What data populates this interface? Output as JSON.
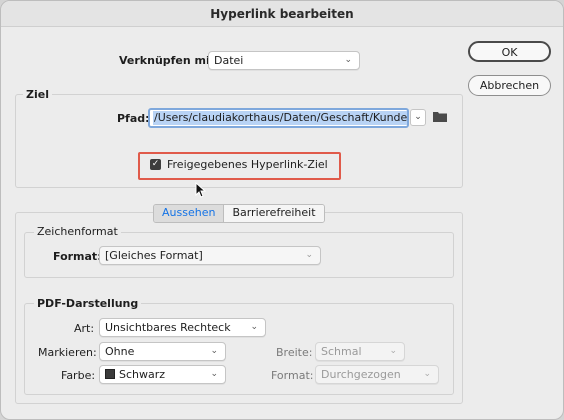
{
  "window": {
    "title": "Hyperlink bearbeiten"
  },
  "buttons": {
    "ok": "OK",
    "cancel": "Abbrechen"
  },
  "link": {
    "label": "Verknüpfen mit:",
    "value": "Datei"
  },
  "ziel": {
    "title": "Ziel",
    "path_label": "Pfad:",
    "path_value": "/Users/claudiakorthaus/Daten/Geschaft/Kunde",
    "checkbox_label": "Freigegebenes Hyperlink-Ziel",
    "checkbox_checked": true
  },
  "tabs": [
    {
      "label": "Aussehen",
      "active": true
    },
    {
      "label": "Barrierefreiheit",
      "active": false
    }
  ],
  "zeichenformat": {
    "title": "Zeichenformat",
    "format_label": "Format:",
    "format_value": "[Gleiches Format]"
  },
  "pdf": {
    "title": "PDF-Darstellung",
    "art_label": "Art:",
    "art_value": "Unsichtbares Rechteck",
    "markieren_label": "Markieren:",
    "markieren_value": "Ohne",
    "breite_label": "Breite:",
    "breite_value": "Schmal",
    "farbe_label": "Farbe:",
    "farbe_value": "Schwarz",
    "format_label": "Format:",
    "format_value": "Durchgezogen"
  },
  "colors": {
    "accent": "#1473e6",
    "highlight": "#e05a4a"
  },
  "icons": {
    "folder": "folder-icon",
    "chevron": "chevron-down-icon",
    "cursor": "cursor-icon"
  }
}
